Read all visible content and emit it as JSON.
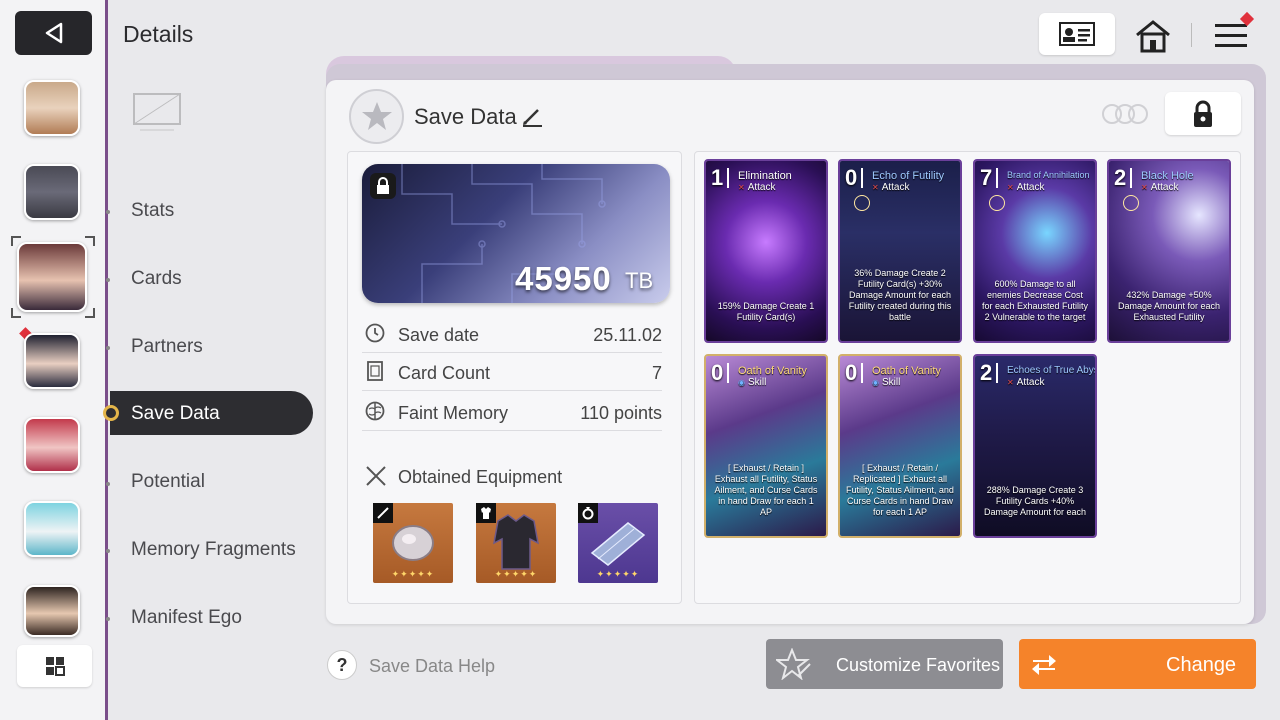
{
  "header": {
    "title": "Details"
  },
  "nav": {
    "items": [
      {
        "label": "Stats"
      },
      {
        "label": "Cards"
      },
      {
        "label": "Partners"
      },
      {
        "label": "Save Data"
      },
      {
        "label": "Potential"
      },
      {
        "label": "Memory Fragments"
      },
      {
        "label": "Manifest Ego"
      }
    ],
    "active": "Save Data"
  },
  "save_data": {
    "title": "Save Data",
    "points": "45950",
    "points_unit": "TB",
    "rows": [
      {
        "label": "Save date",
        "value": "25.11.02"
      },
      {
        "label": "Card Count",
        "value": "7"
      },
      {
        "label": "Faint Memory",
        "value": "110 points"
      }
    ],
    "equipment_title": "Obtained Equipment"
  },
  "cards": [
    {
      "cost": "1",
      "name": "Elimination",
      "type": "Attack",
      "desc": "159% Damage Create 1 Futility Card(s)"
    },
    {
      "cost": "0",
      "name": "Echo of Futility",
      "type": "Attack",
      "desc": "36% Damage Create 2 Futility Card(s) +30% Damage Amount for each Futility created during this battle"
    },
    {
      "cost": "7",
      "name": "Brand of Annihilation",
      "type": "Attack",
      "desc": "600% Damage to all enemies Decrease Cost for each Exhausted Futility 2 Vulnerable to the target"
    },
    {
      "cost": "2",
      "name": "Black Hole",
      "type": "Attack",
      "desc": "432% Damage +50% Damage Amount for each Exhausted Futility"
    },
    {
      "cost": "0",
      "name": "Oath of Vanity",
      "type": "Skill",
      "desc": "[ Exhaust / Retain ] Exhaust all Futility, Status Ailment, and Curse Cards in hand Draw for each 1 AP"
    },
    {
      "cost": "0",
      "name": "Oath of Vanity",
      "type": "Skill",
      "desc": "[ Exhaust / Retain / Replicated ] Exhaust all Futility, Status Ailment, and Curse Cards in hand Draw for each 1 AP"
    },
    {
      "cost": "2",
      "name": "Echoes of True Abyss",
      "type": "Attack",
      "desc": "288% Damage Create 3 Futility Cards +40% Damage Amount for each"
    }
  ],
  "footer": {
    "help": "Save Data Help",
    "favorites": "Customize Favorites",
    "change": "Change"
  },
  "colors": {
    "accent": "#f5832a",
    "nav_active": "#2d2d31",
    "frame": "#7a4e8a"
  }
}
